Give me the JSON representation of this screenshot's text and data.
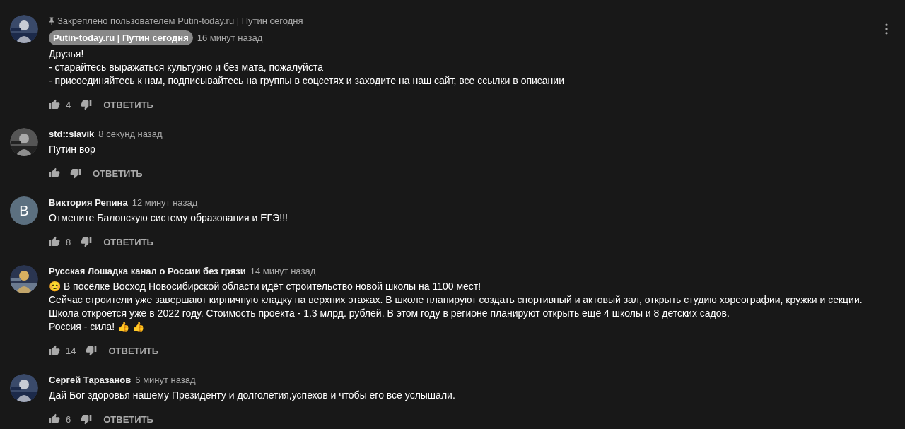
{
  "comments": [
    {
      "avatar": {
        "kind": "picture"
      },
      "pinned_note": "Закреплено пользователем Putin-today.ru | Путин сегодня",
      "author": "Putin-today.ru | Путин сегодня",
      "author_is_owner": true,
      "time": "16 минут назад",
      "lines": [
        "Друзья!",
        "- старайтесь выражаться культурно и без мата, пожалуйста",
        "- присоединяйтесь к нам, подписывайтесь на группы в соцсетях и заходите на наш сайт, все ссылки в описании"
      ],
      "likes": "4",
      "reply": "ОТВЕТИТЬ"
    },
    {
      "avatar": {
        "kind": "picture"
      },
      "author": "std::slavik",
      "author_is_owner": false,
      "time": "8 секунд назад",
      "lines": [
        "Путин вор"
      ],
      "reply": "ОТВЕТИТЬ"
    },
    {
      "avatar": {
        "kind": "letter",
        "letter": "В",
        "color": "#5c7080"
      },
      "author": "Виктория Репина",
      "author_is_owner": false,
      "time": "12 минут назад",
      "lines": [
        "Отмените Балонскую систему образования и ЕГЭ!!!"
      ],
      "likes": "8",
      "reply": "ОТВЕТИТЬ"
    },
    {
      "avatar": {
        "kind": "picture"
      },
      "author": "Русская Лошадка канал о России без грязи",
      "author_is_owner": false,
      "time": "14 минут назад",
      "lines": [
        "😊 В посёлке Восход Новосибирской области идёт строительство новой школы на 1100 мест!",
        "Сейчас строители уже завершают кирпичную кладку на верхних этажах. В школе планируют создать спортивный и актовый зал, открыть студию хореографии, кружки и секции.",
        "Школа откроется уже в 2022 году. Стоимость проекта - 1.3 млрд. рублей. В этом году в регионе планируют открыть ещё 4 школы и 8 детских садов.",
        "Россия - сила! 👍 👍"
      ],
      "likes": "14",
      "reply": "ОТВЕТИТЬ"
    },
    {
      "avatar": {
        "kind": "picture"
      },
      "author": "Сергей Таразанов",
      "author_is_owner": false,
      "time": "6 минут назад",
      "lines": [
        "Дай Бог здоровья нашему Президенту и долголетия,успехов и чтобы его все услышали."
      ],
      "likes": "6",
      "reply": "ОТВЕТИТЬ"
    }
  ]
}
